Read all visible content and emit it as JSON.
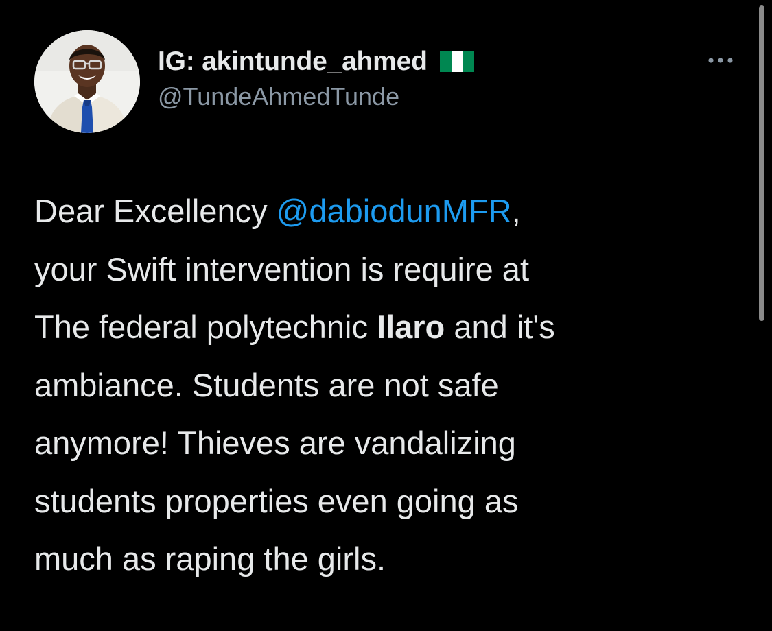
{
  "tweet": {
    "author": {
      "display_name": "IG: akintunde_ahmed",
      "flag_icon": "nigeria-flag-icon",
      "handle": "@TundeAhmedTunde",
      "avatar_icon": "profile-photo-avatar"
    },
    "more_icon": "ellipsis-more-icon",
    "body": {
      "line1_prefix": "Dear Excellency ",
      "line1_mention": "@dabiodunMFR",
      "line1_suffix": ",",
      "line2": "your Swift intervention is require at",
      "line3_prefix": "The federal polytechnic ",
      "line3_bold": "Ilaro",
      "line3_suffix": " and it's",
      "line4": "ambiance. Students are not safe",
      "line5": "anymore! Thieves are vandalizing",
      "line6": "students properties even going as",
      "line7": "much as raping the girls."
    }
  },
  "colors": {
    "background": "#000000",
    "text_primary": "#e7e9ea",
    "text_secondary": "#8b98a5",
    "mention": "#1d9bf0",
    "flag_green": "#008751",
    "flag_white": "#ffffff"
  }
}
